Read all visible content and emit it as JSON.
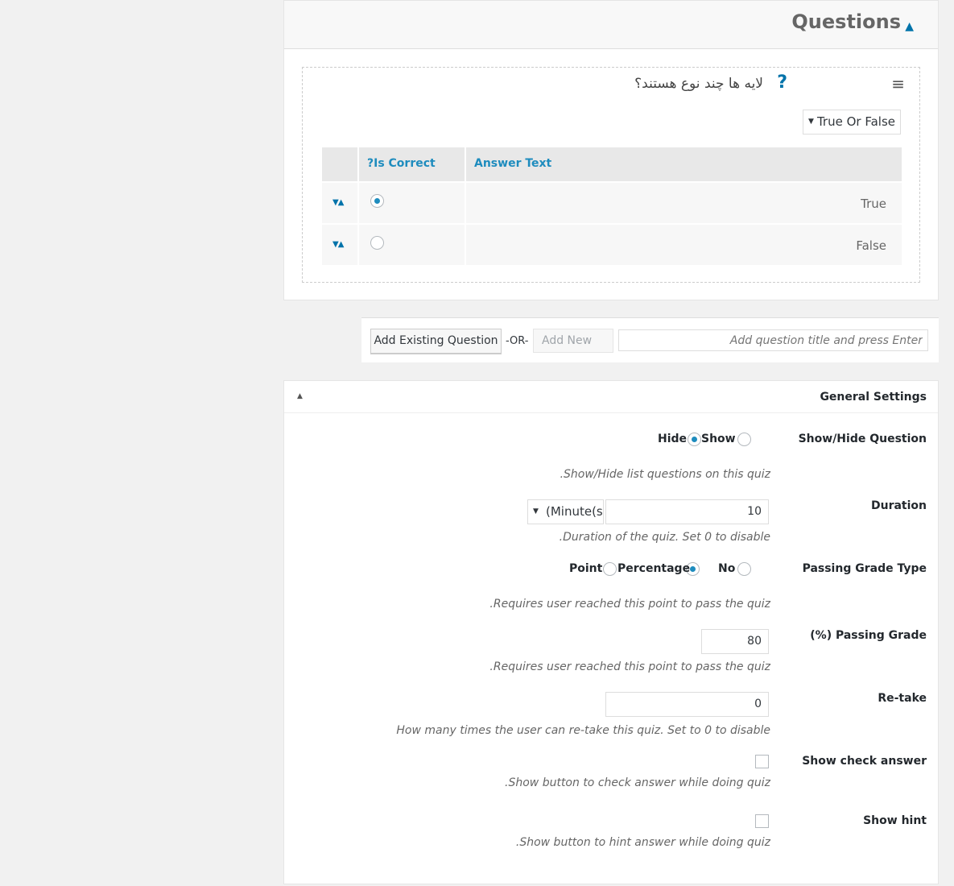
{
  "questions": {
    "title": "Questions",
    "question_title": "لایه ها چند نوع هستند؟",
    "type_select": "True Or False",
    "columns": {
      "is_correct": "?Is Correct",
      "answer_text": "Answer Text"
    },
    "answers": [
      {
        "text": "True",
        "correct": true
      },
      {
        "text": "False",
        "correct": false
      }
    ],
    "add_existing_label": "Add Existing Question",
    "or_label": "-OR-",
    "add_new_label": "Add New",
    "new_question_placeholder": "Add question title and press Enter"
  },
  "settings": {
    "title": "General Settings",
    "show_hide": {
      "label": "Show/Hide Question",
      "option_show": "Show",
      "option_hide": "Hide",
      "selected": "Hide",
      "desc": ".Show/Hide list questions on this quiz"
    },
    "duration": {
      "label": "Duration",
      "value": "10",
      "unit": "(Minute(s",
      "desc": ".Duration of the quiz. Set 0 to disable"
    },
    "passing_type": {
      "label": "Passing Grade Type",
      "option_no": "No",
      "option_percentage": "Percentage",
      "option_point": "Point",
      "selected": "Percentage",
      "desc": ".Requires user reached this point to pass the quiz"
    },
    "passing_grade": {
      "label": "(%) Passing Grade",
      "value": "80",
      "desc": ".Requires user reached this point to pass the quiz"
    },
    "retake": {
      "label": "Re-take",
      "value": "0",
      "desc": "How many times the user can re-take this quiz. Set to 0 to disable"
    },
    "check_answer": {
      "label": "Show check answer",
      "checked": false,
      "desc": ".Show button to check answer while doing quiz"
    },
    "hint": {
      "label": "Show hint",
      "checked": false,
      "desc": ".Show button to hint answer while doing quiz"
    }
  },
  "colors": {
    "accent": "#0073aa",
    "header_bg": "#f8f8f8"
  }
}
